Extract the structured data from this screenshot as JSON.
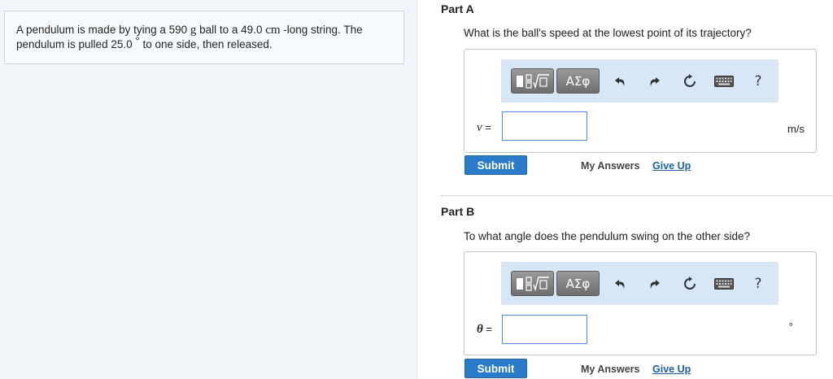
{
  "problem": {
    "text_before_mass": "A pendulum is made by tying a 590 ",
    "mass_unit": "g",
    "text_before_length": " ball to a 49.0 ",
    "length_unit": "cm",
    "text_line1_end": " -long string. The",
    "text_line2_start": "pendulum is pulled 25.0 ",
    "degree_symbol": "°",
    "text_line2_end": " to one side, then released."
  },
  "part_a": {
    "title": "Part A",
    "question": "What is the ball's speed at the lowest point of its trajectory?",
    "variable": "v",
    "equals": " =",
    "input_value": "",
    "unit": "m/s",
    "submit_label": "Submit",
    "my_answers_label": "My Answers",
    "give_up_label": "Give Up"
  },
  "part_b": {
    "title": "Part B",
    "question": "To what angle does the pendulum swing on the other side?",
    "variable": "θ",
    "equals": " =",
    "input_value": "",
    "unit": "°",
    "submit_label": "Submit",
    "my_answers_label": "My Answers",
    "give_up_label": "Give Up"
  },
  "toolbar": {
    "greek_label": "ΑΣφ",
    "help_label": "?",
    "icons": [
      "fraction-root-icon",
      "undo-icon",
      "redo-icon",
      "reset-icon",
      "keyboard-icon"
    ]
  },
  "colors": {
    "submit_blue": "#2a7bc9",
    "toolbar_bg": "#d7e7f6",
    "link_blue": "#1d5fa8",
    "input_border": "#4a90d9"
  }
}
